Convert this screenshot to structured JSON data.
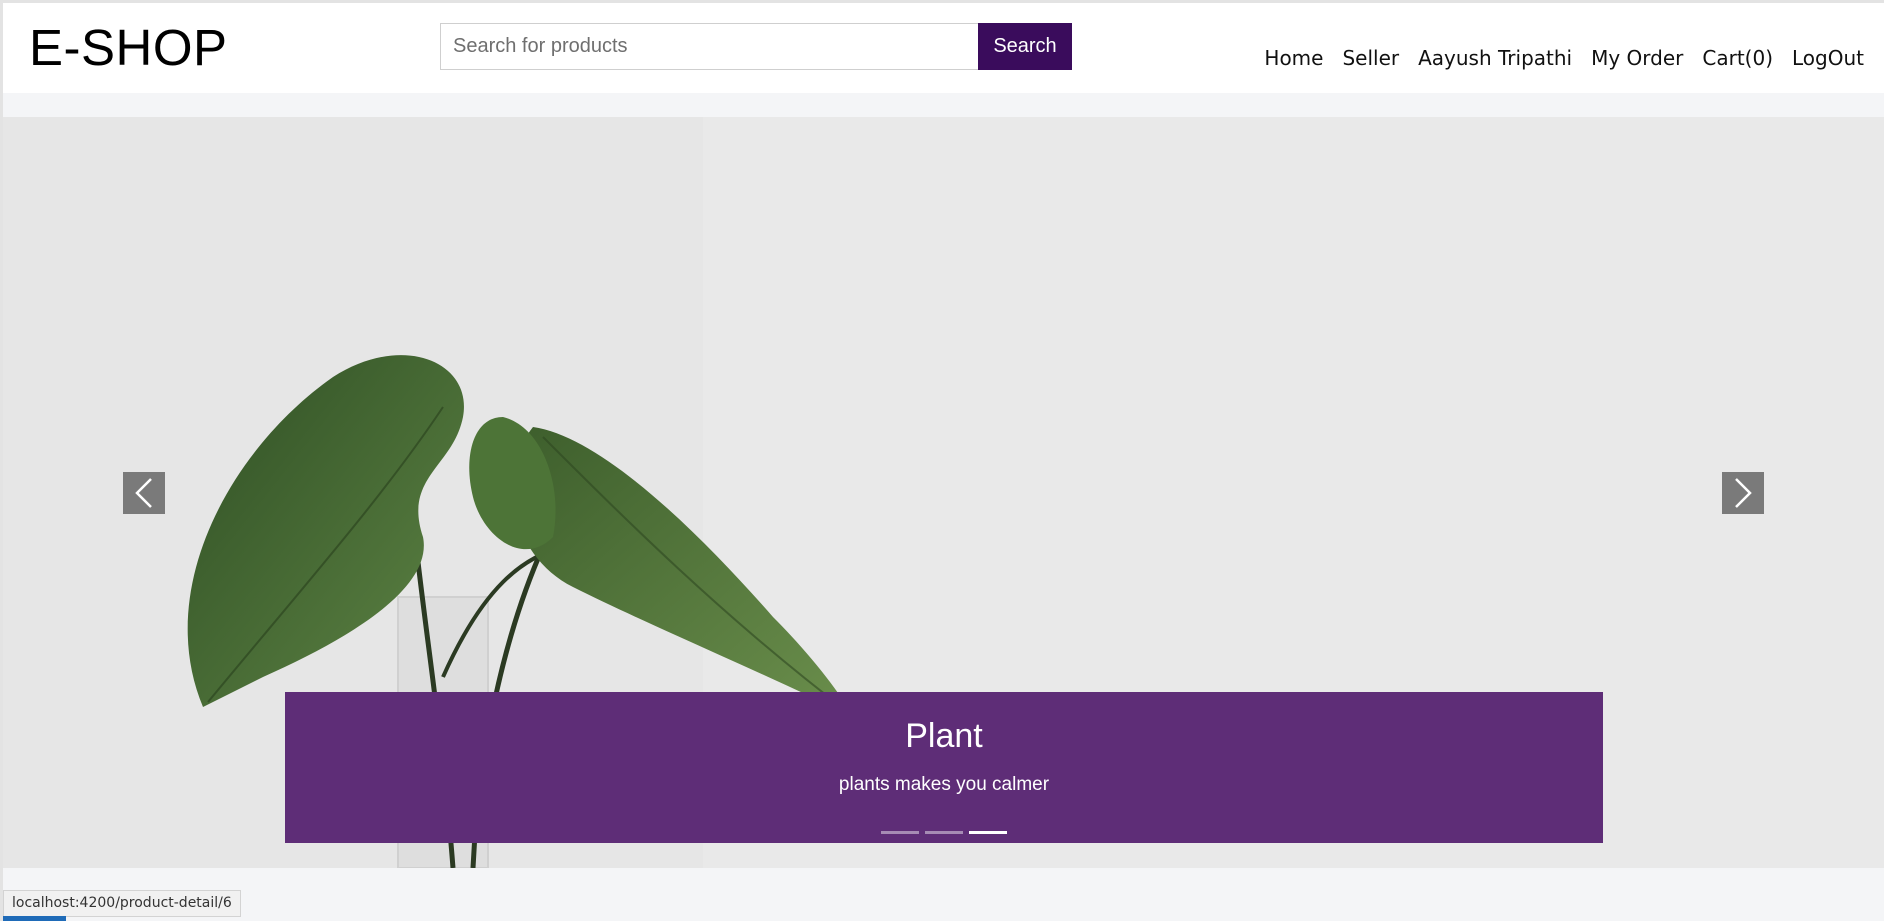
{
  "header": {
    "logo": "E-SHOP",
    "search": {
      "placeholder": "Search for products",
      "value": "",
      "button_label": "Search"
    },
    "nav": [
      {
        "label": "Home"
      },
      {
        "label": "Seller"
      },
      {
        "label": "Aayush Tripathi"
      },
      {
        "label": "My Order"
      },
      {
        "label": "Cart(0)"
      },
      {
        "label": "LogOut"
      }
    ]
  },
  "carousel": {
    "caption_title": "Plant",
    "caption_text": "plants makes you calmer",
    "slide_count": 3,
    "active_index": 2,
    "prev_icon": "chevron-left-icon",
    "next_icon": "chevron-right-icon"
  },
  "status_bar": {
    "url": "localhost:4200/product-detail/6"
  },
  "colors": {
    "accent": "#3a0c5c",
    "caption_bg": "#5e2d77",
    "header_bg": "#ffffff",
    "page_bg": "#f4f5f7"
  }
}
